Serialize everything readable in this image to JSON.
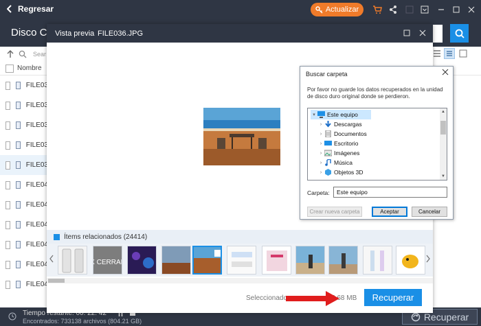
{
  "topbar": {
    "back_label": "Regresar",
    "update_label": "Actualizar"
  },
  "header": {
    "disk_title": "Disco C"
  },
  "list": {
    "column_name": "Nombre",
    "search_placeholder": "Sear",
    "files": [
      "FILE03",
      "FILE03",
      "FILE03",
      "FILE03",
      "FILE03",
      "FILE04",
      "FILE04",
      "FILE04",
      "FILE04",
      "FILE04",
      "FILE04"
    ]
  },
  "preview": {
    "title": "Vista previa",
    "filename": "FILE036.JPG",
    "related_label": "Ítems relacionados (24414)",
    "selected_label": "Seleccionado",
    "size_label": "5.68 MB",
    "recover_label": "Recuperar",
    "thumb_caption": "X CERRAR"
  },
  "folder_dialog": {
    "title": "Buscar carpeta",
    "message": "Por favor no guarde los datos recuperados en la unidad de disco duro original donde se perdieron.",
    "tree": [
      "Este equipo",
      "Descargas",
      "Documentos",
      "Escritorio",
      "Imágenes",
      "Música",
      "Objetos 3D"
    ],
    "folder_label": "Carpeta:",
    "folder_value": "Este equipo",
    "new_folder_label": "Crear nueva carpeta",
    "accept_label": "Aceptar",
    "cancel_label": "Cancelar"
  },
  "status": {
    "time_remaining": "Tiempo restante: 00: 22: 42",
    "found": "Encontrados: 733138 archivos (804.21 GB)",
    "recover_label": "Recuperar"
  },
  "colors": {
    "accent": "#1a8fe6",
    "update": "#f07b2a",
    "dark": "#2f3644"
  }
}
